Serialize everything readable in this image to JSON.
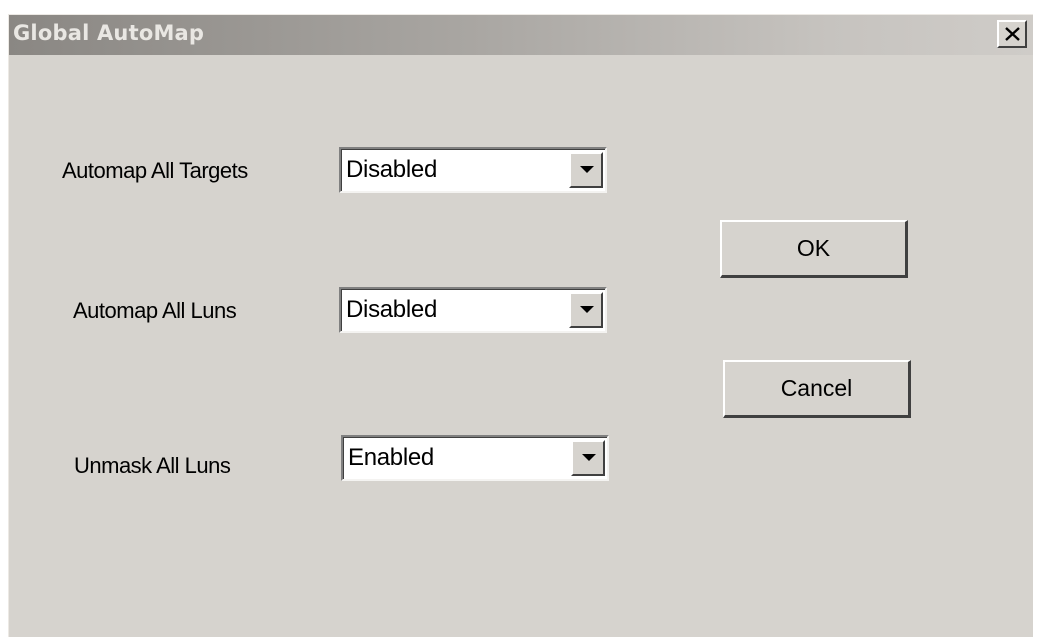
{
  "window": {
    "title": "Global AutoMap",
    "close_glyph": "X"
  },
  "fields": [
    {
      "label": "Automap All Targets",
      "value": "Disabled",
      "options_icon": "chevron-down-icon"
    },
    {
      "label": "Automap All Luns",
      "value": "Disabled",
      "options_icon": "chevron-down-icon"
    },
    {
      "label": "Unmask All Luns",
      "value": "Enabled",
      "options_icon": "chevron-down-icon"
    }
  ],
  "buttons": {
    "ok_label": "OK",
    "cancel_label": "Cancel"
  },
  "colors": {
    "dialog_face": "#d6d3ce",
    "titlebar_inactive_start": "#8a8783",
    "titlebar_inactive_end": "#cfccc8",
    "field_background": "#ffffff"
  }
}
